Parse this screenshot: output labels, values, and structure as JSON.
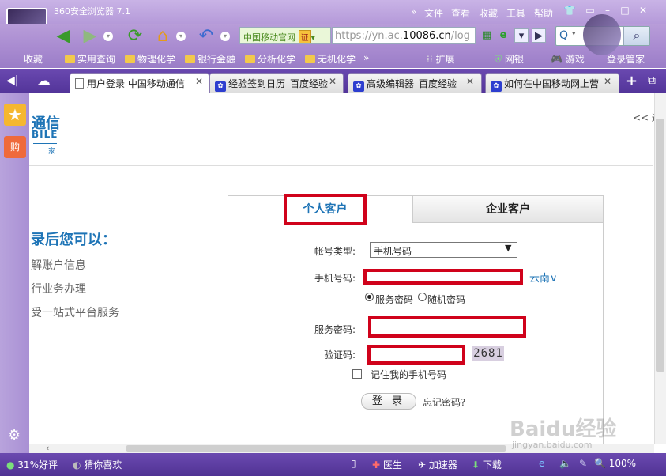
{
  "window": {
    "title": "360安全浏览器 7.1",
    "menu": [
      "文件",
      "查看",
      "收藏",
      "工具",
      "帮助"
    ]
  },
  "toolbar": {
    "site_name": "中国移动官网",
    "cert": "证",
    "url_prefix": "https://yn.ac.",
    "url_domain": "10086.cn",
    "url_suffix": "/log"
  },
  "bookmarks": {
    "items": [
      "收藏",
      "实用查询",
      "物理化学",
      "银行金融",
      "分析化学",
      "无机化学"
    ],
    "more": "»",
    "right": [
      "扩展",
      "网银",
      "游戏",
      "登录管家"
    ]
  },
  "tabs": [
    {
      "label": "用户登录 中国移动通信"
    },
    {
      "label": "经验签到日历_百度经验"
    },
    {
      "label": "高级编辑器_百度经验"
    },
    {
      "label": "如何在中国移动网上营"
    }
  ],
  "page": {
    "logo_line1": "通信",
    "logo_line2": "BILE",
    "logo_line3": "家",
    "back_link": "<< 返",
    "after_title": "录后您可以：",
    "benefits": [
      "解账户信息",
      "行业务办理",
      "受一站式平台服务"
    ]
  },
  "login": {
    "tab_personal": "个人客户",
    "tab_enterprise": "企业客户",
    "account_type_label": "帐号类型:",
    "account_type_value": "手机号码",
    "phone_label": "手机号码:",
    "phone_value": "",
    "region": "云南",
    "radio_service": "服务密码",
    "radio_random": "随机密码",
    "password_label": "服务密码:",
    "password_value": "",
    "captcha_label": "验证码:",
    "captcha_value": "",
    "captcha_image": "2681",
    "remember": "记住我的手机号码",
    "login_button": "登 录",
    "forgot": "忘记密码?"
  },
  "statusbar": {
    "rating": "31%好评",
    "guess": "猜你喜欢",
    "doctor": "医生",
    "accelerator": "加速器",
    "download": "下载",
    "zoom": "100%"
  },
  "watermark": {
    "brand": "Baidu经验",
    "url": "jingyan.baidu.com"
  }
}
